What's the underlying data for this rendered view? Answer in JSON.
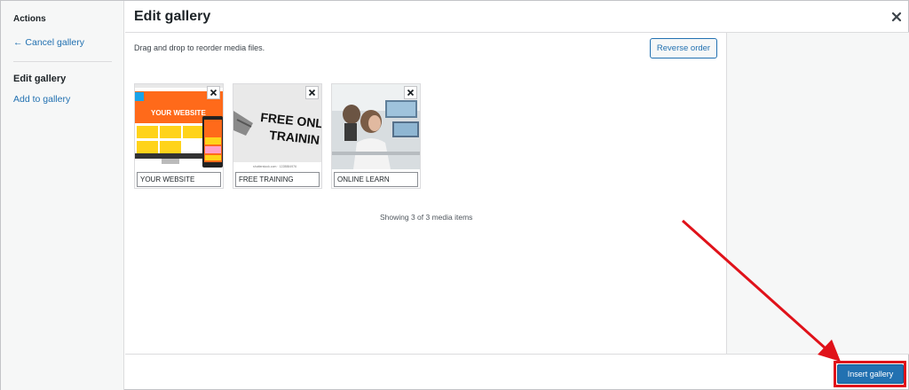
{
  "sidebar": {
    "heading": "Actions",
    "cancel_label": "← Cancel gallery",
    "active_label": "Edit gallery",
    "add_label": "Add to gallery"
  },
  "header": {
    "title": "Edit gallery",
    "close_icon": "close-icon"
  },
  "content": {
    "instructions": "Drag and drop to reorder media files.",
    "reverse_label": "Reverse order",
    "items": [
      {
        "caption": "YOUR WEBSITE",
        "image_text": "YOUR WEBSITE"
      },
      {
        "caption": "FREE TRAINING",
        "image_text": "FREE ONLIN TRAININ",
        "image_line1": "FREE ONLIN",
        "image_line2": "TRAININ",
        "credit": "shutterstock.com · 1228884976"
      },
      {
        "caption": "ONLINE LEARN"
      }
    ],
    "showing": "Showing 3 of 3 media items"
  },
  "footer": {
    "insert_label": "Insert gallery"
  },
  "colors": {
    "accent": "#2271b1",
    "highlight": "#e0121a"
  }
}
